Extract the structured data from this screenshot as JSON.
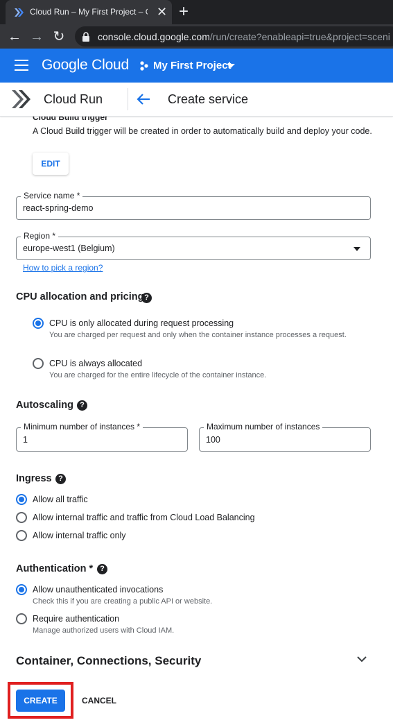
{
  "browser": {
    "tab_title": "Cloud Run – My First Project – Go",
    "url_host": "console.cloud.google.com",
    "url_path": "/run/create?enableapi=true&project=sceni"
  },
  "gcp_header": {
    "logo": "Google Cloud",
    "project": "My First Project"
  },
  "product_header": {
    "product": "Cloud Run",
    "page_title": "Create service"
  },
  "cloud_build": {
    "title": "Cloud Build trigger",
    "description": "A Cloud Build trigger will be created in order to automatically build and deploy your code.",
    "edit_label": "EDIT"
  },
  "service_name": {
    "label": "Service name *",
    "value": "react-spring-demo"
  },
  "region": {
    "label": "Region *",
    "value": "europe-west1 (Belgium)",
    "help_link": "How to pick a region?"
  },
  "cpu": {
    "title": "CPU allocation and pricing",
    "options": [
      {
        "label": "CPU is only allocated during request processing",
        "help": "You are charged per request and only when the container instance processes a request.",
        "checked": true
      },
      {
        "label": "CPU is always allocated",
        "help": "You are charged for the entire lifecycle of the container instance.",
        "checked": false
      }
    ]
  },
  "autoscaling": {
    "title": "Autoscaling",
    "min_label": "Minimum number of instances *",
    "min_value": "1",
    "max_label": "Maximum number of instances",
    "max_value": "100"
  },
  "ingress": {
    "title": "Ingress",
    "options": [
      {
        "label": "Allow all traffic",
        "checked": true
      },
      {
        "label": "Allow internal traffic and traffic from Cloud Load Balancing",
        "checked": false
      },
      {
        "label": "Allow internal traffic only",
        "checked": false
      }
    ]
  },
  "authentication": {
    "title": "Authentication *",
    "options": [
      {
        "label": "Allow unauthenticated invocations",
        "help": "Check this if you are creating a public API or website.",
        "checked": true
      },
      {
        "label": "Require authentication",
        "help": "Manage authorized users with Cloud IAM.",
        "checked": false
      }
    ]
  },
  "advanced": {
    "title": "Container, Connections, Security"
  },
  "actions": {
    "create": "CREATE",
    "cancel": "CANCEL"
  },
  "colors": {
    "accent": "#1a73e8",
    "highlight": "#e02020"
  }
}
